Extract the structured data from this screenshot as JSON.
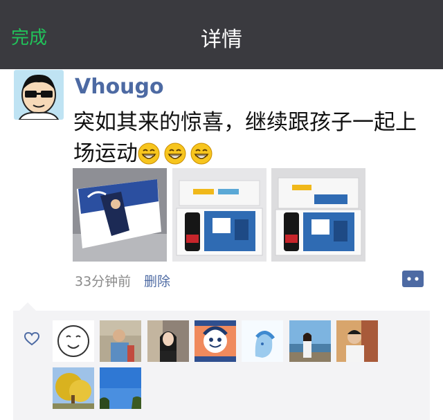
{
  "nav": {
    "back_label": "完成",
    "title": "详情"
  },
  "post": {
    "author": "Vhougo",
    "text": "突如其来的惊喜，继续跟孩子一起上场运动",
    "time": "33分钟前",
    "delete_label": "删除",
    "photos": [
      {
        "icon": "photo-gift-box"
      },
      {
        "icon": "photo-box-open"
      },
      {
        "icon": "photo-box-open-2"
      }
    ]
  },
  "likes": {
    "count": 9,
    "avatars": [
      "sketch-face",
      "child",
      "girl",
      "cartoon",
      "blue-drawing",
      "lakeside-girl",
      "boy",
      "yellow-tree",
      "blue-sky"
    ]
  },
  "colors": {
    "nav_bg": "#3a3a3f",
    "accent_green": "#21c25a",
    "link_blue": "#4d6aa3",
    "panel_bg": "#f3f3f5"
  }
}
